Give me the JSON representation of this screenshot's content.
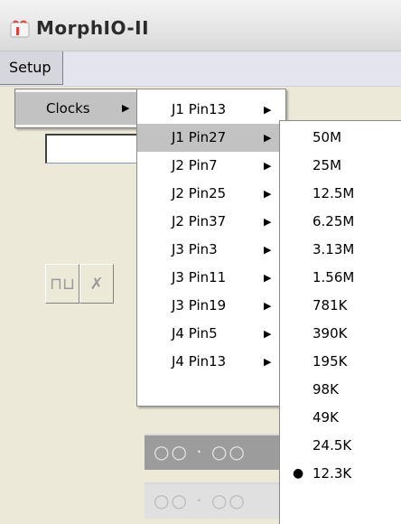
{
  "window": {
    "title": "MorphIO-II",
    "icon": "morphio-app-icon"
  },
  "menubar": {
    "setup": "Setup"
  },
  "setup_menu": {
    "items": [
      {
        "label": "Clocks",
        "has_submenu": true
      }
    ]
  },
  "clocks_menu": {
    "items": [
      {
        "label": "J1 Pin13"
      },
      {
        "label": "J1 Pin27",
        "highlighted": true
      },
      {
        "label": "J2 Pin7"
      },
      {
        "label": "J2 Pin25"
      },
      {
        "label": "J2 Pin37"
      },
      {
        "label": "J3 Pin3"
      },
      {
        "label": "J3 Pin11"
      },
      {
        "label": "J3 Pin19"
      },
      {
        "label": "J4 Pin5"
      },
      {
        "label": "J4 Pin13"
      }
    ]
  },
  "frequency_menu": {
    "items": [
      {
        "label": "50M"
      },
      {
        "label": "25M"
      },
      {
        "label": "12.5M"
      },
      {
        "label": "6.25M"
      },
      {
        "label": "3.13M"
      },
      {
        "label": "1.56M"
      },
      {
        "label": "781K"
      },
      {
        "label": "390K"
      },
      {
        "label": "195K"
      },
      {
        "label": "98K"
      },
      {
        "label": "49K"
      },
      {
        "label": "24.5K"
      },
      {
        "label": "12.3K",
        "selected": true
      }
    ]
  },
  "background": {
    "dots_row_1": "○○ · ○○",
    "dots_row_2": "○○ · ○○"
  },
  "colors": {
    "menu_highlight": "#c2c2c2",
    "menubar": "#e4e4ee",
    "window_bg": "#ece9d8"
  }
}
